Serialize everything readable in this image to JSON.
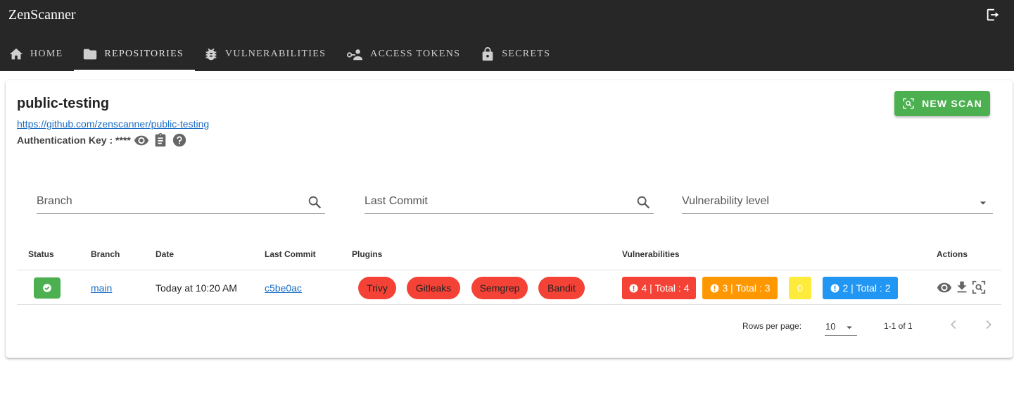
{
  "app": {
    "title": "ZenScanner",
    "logout_icon": "logout-icon"
  },
  "nav": {
    "tabs": [
      {
        "label": "HOME",
        "icon": "home-icon",
        "active": false
      },
      {
        "label": "REPOSITORIES",
        "icon": "folder-icon",
        "active": true
      },
      {
        "label": "VULNERABILITIES",
        "icon": "bug-icon",
        "active": false
      },
      {
        "label": "ACCESS TOKENS",
        "icon": "access-token-icon",
        "active": false
      },
      {
        "label": "SECRETS",
        "icon": "lock-icon",
        "active": false
      }
    ]
  },
  "repo": {
    "name": "public-testing",
    "url": "https://github.com/zenscanner/public-testing",
    "auth_label": "Authentication Key : ****",
    "new_scan_label": "NEW SCAN"
  },
  "filters": {
    "branch_placeholder": "Branch",
    "commit_placeholder": "Last Commit",
    "level_placeholder": "Vulnerability level"
  },
  "table": {
    "headers": {
      "status": "Status",
      "branch": "Branch",
      "date": "Date",
      "commit": "Last Commit",
      "plugins": "Plugins",
      "vulnerabilities": "Vulnerabilities",
      "actions": "Actions"
    },
    "rows": [
      {
        "status": "success",
        "branch": "main",
        "date": "Today at 10:20 AM",
        "commit": "c5be0ac",
        "plugins": [
          "Trivy",
          "Gitleaks",
          "Semgrep",
          "Bandit"
        ],
        "vulnerabilities": [
          "4 | Total : 4",
          "3 | Total : 3",
          "0",
          "2 | Total : 2"
        ]
      }
    ]
  },
  "pagination": {
    "rows_per_page_label": "Rows per page:",
    "rows_per_page": "10",
    "range": "1-1 of 1"
  },
  "colors": {
    "appbar": "#272727",
    "success": "#4caf50",
    "plugin": "#f44336",
    "critical": "#f44336",
    "high": "#ff9800",
    "medium": "#ffeb3b",
    "low": "#2196f3",
    "link": "#1a6dc4"
  }
}
